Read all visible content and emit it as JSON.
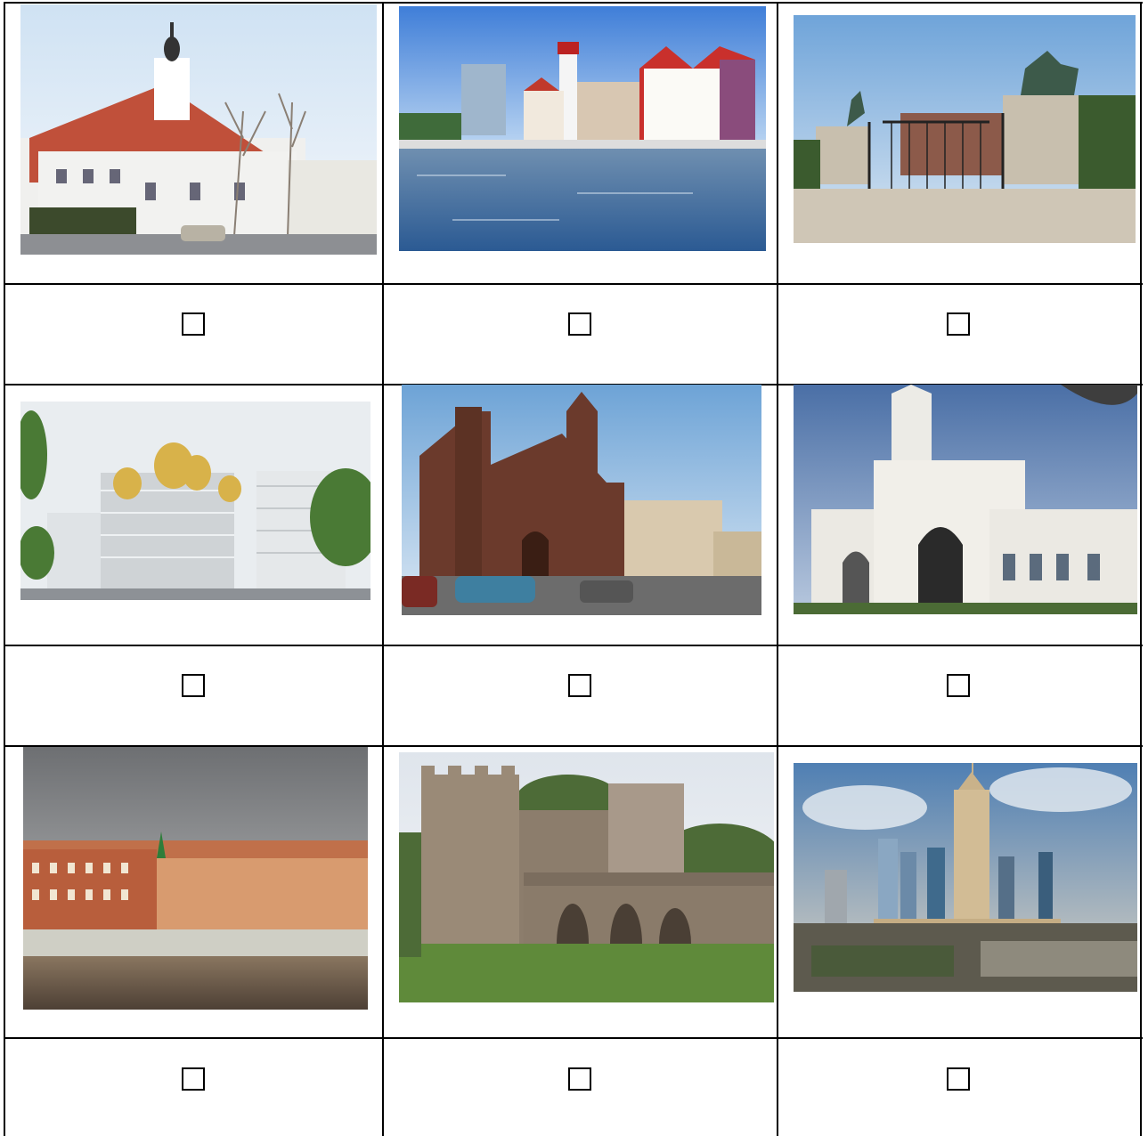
{
  "table": {
    "rows": 3,
    "columns": 3,
    "cells": [
      {
        "photo": "church-with-red-roof-photo",
        "checked": false
      },
      {
        "photo": "riverside-fish-village-lighthouse-photo",
        "checked": false
      },
      {
        "photo": "park-gate-equestrian-statues-photo",
        "checked": false
      },
      {
        "photo": "modern-orthodox-cathedral-rendering-photo",
        "checked": false
      },
      {
        "photo": "brick-catholic-church-photo",
        "checked": false
      },
      {
        "photo": "gothic-white-palace-photo",
        "checked": false
      },
      {
        "photo": "embankment-red-brick-buildings-photo",
        "checked": false
      },
      {
        "photo": "stone-fortress-bridge-photo",
        "checked": false
      },
      {
        "photo": "city-skyline-palace-of-culture-photo",
        "checked": false
      }
    ]
  }
}
